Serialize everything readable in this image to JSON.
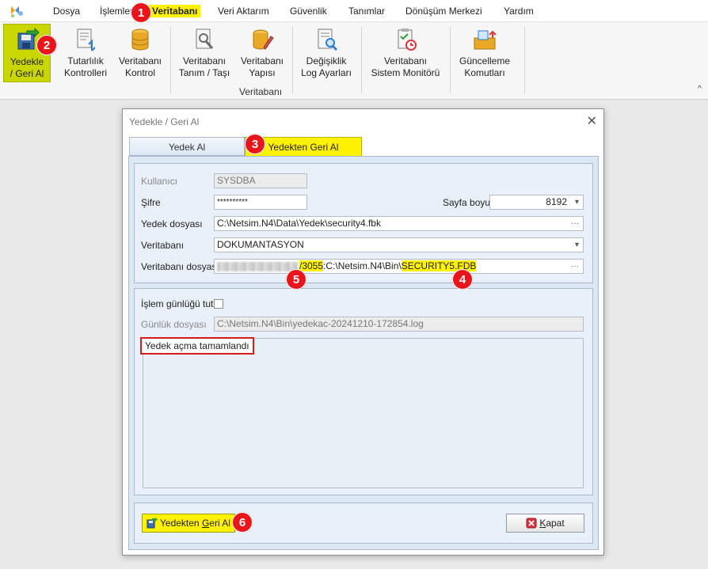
{
  "menu": {
    "items": [
      "Dosya",
      "İşlemler",
      "Veritabanı",
      "Veri Aktarım",
      "Güvenlik",
      "Tanımlar",
      "Dönüşüm Merkezi",
      "Yardım"
    ],
    "active_index": 2
  },
  "ribbon": {
    "buttons": [
      {
        "line1": "Yedekle",
        "line2": "/ Geri Al"
      },
      {
        "line1": "Tutarlılık",
        "line2": "Kontrolleri"
      },
      {
        "line1": "Veritabanı",
        "line2": "Kontrol"
      },
      {
        "line1": "Veritabanı",
        "line2": "Tanım / Taşı"
      },
      {
        "line1": "Veritabanı",
        "line2": "Yapısı"
      },
      {
        "line1": "Değişiklik",
        "line2": "Log Ayarları"
      },
      {
        "line1": "Veritabanı",
        "line2": "Sistem Monitörü"
      },
      {
        "line1": "Güncelleme",
        "line2": "Komutları"
      }
    ],
    "group_label": "Veritabanı",
    "collapse_glyph": "^"
  },
  "dialog": {
    "title": "Yedekle / Geri Al",
    "close_glyph": "✕",
    "tabs": [
      "Yedek Al",
      "Yedekten Geri Al"
    ],
    "active_tab": 1,
    "form": {
      "user_label": "Kullanıcı",
      "user_value": "SYSDBA",
      "password_label": "Şifre",
      "password_value": "**********",
      "page_size_label": "Sayfa boyu",
      "page_size_value": "8192",
      "backup_file_label": "Yedek dosyası",
      "backup_file_value": "C:\\Netsim.N4\\Data\\Yedek\\security4.fbk",
      "database_label": "Veritabanı",
      "database_value": "DOKUMANTASYON",
      "db_file_label": "Veritabanı dosyası",
      "db_file_port": "/3055",
      "db_file_path": ":C:\\Netsim.N4\\Bin\\",
      "db_file_name": "SECURITY5.FDB",
      "ellipsis": "···"
    },
    "log": {
      "keep_log_label": "İşlem günlüğü tut",
      "keep_log_checked": false,
      "log_file_label": "Günlük dosyası",
      "log_file_value": "C:\\Netsim.N4\\Bin\\yedekac-20241210-172854.log",
      "output_line": "Yedek açma tamamlandı"
    },
    "buttons": {
      "restore_prefix": "Yedekten ",
      "restore_underlined": "G",
      "restore_suffix": "eri Al",
      "close_underlined": "K",
      "close_suffix": "apat"
    }
  },
  "annotations": [
    "1",
    "2",
    "3",
    "4",
    "5",
    "6"
  ],
  "colors": {
    "highlight": "#fff200",
    "badge": "#e8161b",
    "ribbon_selected": "#c9d600",
    "log_box_border": "#d81b1b"
  }
}
